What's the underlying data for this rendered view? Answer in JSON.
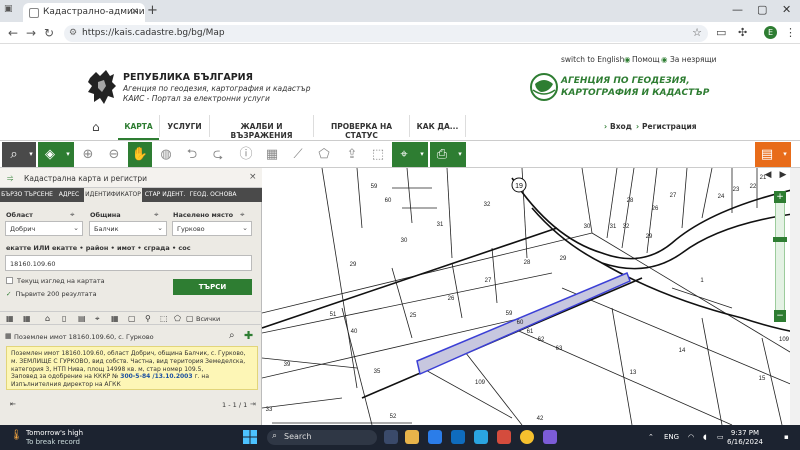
{
  "browser": {
    "tab_title": "Кадастрално-административна",
    "tab_close": "×",
    "new_tab": "+",
    "url": "https://kais.cadastre.bg/bg/Map",
    "avatar_letter": "E",
    "win_min": "—",
    "win_max": "▢",
    "win_close": "✕"
  },
  "header": {
    "top_links": [
      "switch to English",
      "Помощ",
      "За незрящи"
    ],
    "republic": "РЕПУБЛИКА БЪЛГАРИЯ",
    "agency_line": "Агенция по геодезия, картография и кадастър",
    "portal_line": "КАИС - Портал за електронни услуги",
    "agency_logo_line1": "АГЕНЦИЯ ПО ГЕОДЕЗИЯ,",
    "agency_logo_line2": "КАРТОГРАФИЯ И КАДАСТЪР"
  },
  "menu": {
    "items": [
      "КАРТА",
      "УСЛУГИ",
      "ЖАЛБИ И ВЪЗРАЖЕНИЯ",
      "ПРОВЕРКА НА СТАТУС",
      "КАК ДА..."
    ],
    "login": "Вход",
    "register": "Регистрация"
  },
  "panel": {
    "title": "Кадастрална карта и регистри",
    "tabs": [
      "БЪРЗО ТЪРСЕНЕ",
      "АДРЕС",
      "ИДЕНТИФИКАТОР",
      "СТАР ИДЕНТ.",
      "ГЕОД. ОСНОВА"
    ],
    "active_tab": 2,
    "fields": {
      "oblast_label": "Област",
      "oblast_value": "Добрич",
      "obshtina_label": "Община",
      "obshtina_value": "Балчик",
      "place_label": "Населено място",
      "place_value": "Гурково"
    },
    "query_label": "екатте ИЛИ екатте • район • имот • сграда • сос",
    "query_value": "18160.109.60",
    "check_current_view": "Текущ изглед на картата",
    "check_first_200": "Първите 200 резултата",
    "search_button": "ТЪРСИ",
    "filter_all": "Всички",
    "result_title": "Поземлен имот 18160.109.60, с. Гурково",
    "result_text": "Поземлен имот 18160.109.60, област Добрич, община Балчик, с. Гурково, м. ЗЕМЛИЩЕ С ГУРКОВО, вид собств. Частна, вид територия Земеделска, категория 3, НТП Нива, площ 14998 кв. м, стар номер 109.5,",
    "result_order_prefix": "Заповед за одобрение на КККР №",
    "result_order_link": "300-5-84 /13.10.2003",
    "result_order_suffix": "г. на Изпълнителния директор на АГКК",
    "pager_first": "⇤",
    "pager_count": "1 - 1 / 1"
  },
  "map": {
    "parcel_labels": [
      "59",
      "60",
      "32",
      "30",
      "31",
      "29",
      "28",
      "27",
      "26",
      "25",
      "51",
      "40",
      "39",
      "35",
      "33",
      "52",
      "42",
      "109",
      "14",
      "13",
      "15",
      "63",
      "62",
      "61",
      "60",
      "59",
      "1",
      "29",
      "30",
      "31",
      "32",
      "28",
      "26",
      "27",
      "23",
      "22",
      "24",
      "21",
      "109",
      "29"
    ],
    "highlight_color": "#3b3fd6",
    "zoom_plus": "+",
    "zoom_minus": "−",
    "circle_label": "19"
  },
  "taskbar": {
    "weather_title": "Tomorrow's high",
    "weather_sub": "To break record",
    "search_placeholder": "Search",
    "lang": "ENG",
    "time": "9:37 PM",
    "date": "6/16/2024"
  }
}
